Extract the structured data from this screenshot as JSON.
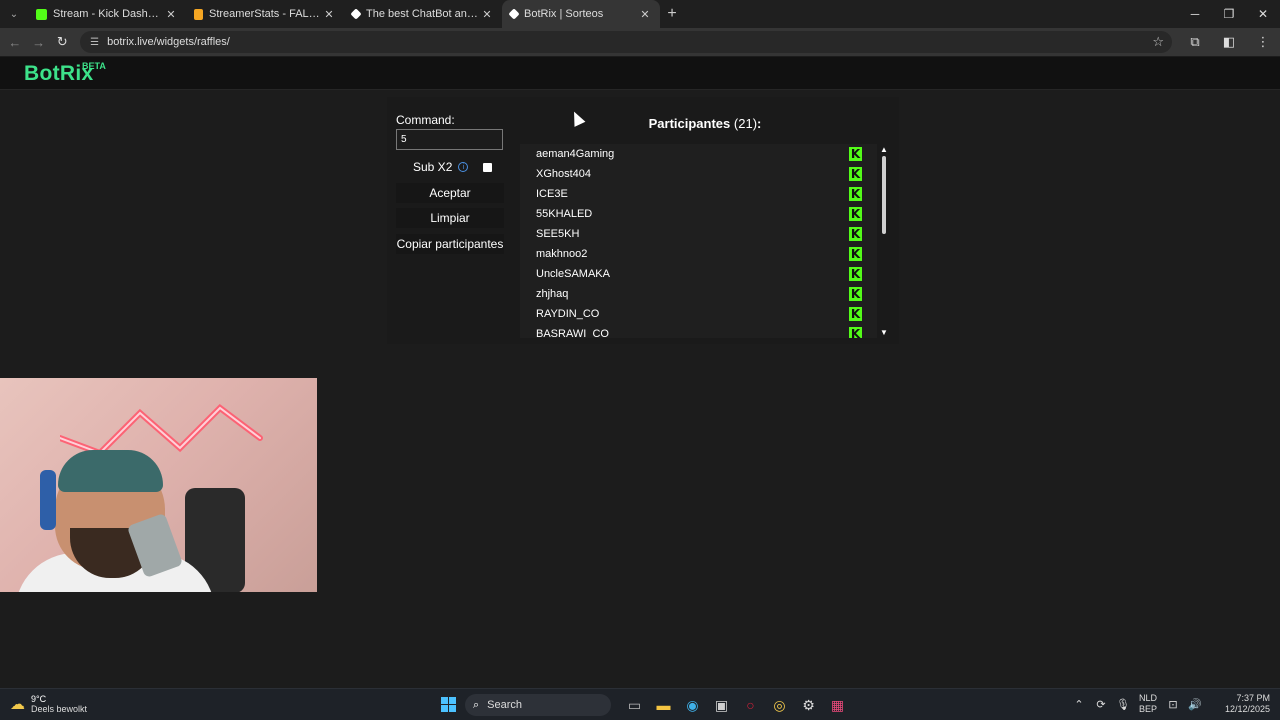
{
  "browser": {
    "tabs": [
      {
        "label": "Stream - Kick Dashboard",
        "favicon_color": "#53fc18",
        "active": false
      },
      {
        "label": "StreamerStats - FALAFELCO Profile",
        "favicon_color": "#f5a623",
        "active": false
      },
      {
        "label": "The best ChatBot and Widgets",
        "favicon_color": "#ffffff",
        "active": false
      },
      {
        "label": "BotRix | Sorteos",
        "favicon_color": "#ffffff",
        "active": true
      }
    ],
    "url": "botrix.live/widgets/raffles/"
  },
  "site": {
    "logo": "BotRix",
    "badge": "BETA",
    "brand_color": "#3de28a"
  },
  "raffle": {
    "command_label": "Command:",
    "command_value": "5",
    "sub_x2_label": "Sub X2",
    "accept_label": "Aceptar",
    "clear_label": "Limpiar",
    "copy_label": "Copiar participantes",
    "participants_title": "Participantes",
    "participants_count": "(21)",
    "participants_colon": ":",
    "participants": [
      "aeman4Gaming",
      "XGhost404",
      "ICE3E",
      "55KHALED",
      "SEE5KH",
      "makhnoo2",
      "UncleSAMAKA",
      "zhjhaq",
      "RAYDIN_CO",
      "BASRAWI_CO"
    ],
    "platform_icon": "kick-icon",
    "platform_color": "#53fc18"
  },
  "taskbar": {
    "temperature": "9°C",
    "weather": "Deels bewolkt",
    "search": "Search",
    "lang_1": "NLD",
    "lang_2": "BEP",
    "time": "7:37 PM",
    "date": "12/12/2025"
  }
}
